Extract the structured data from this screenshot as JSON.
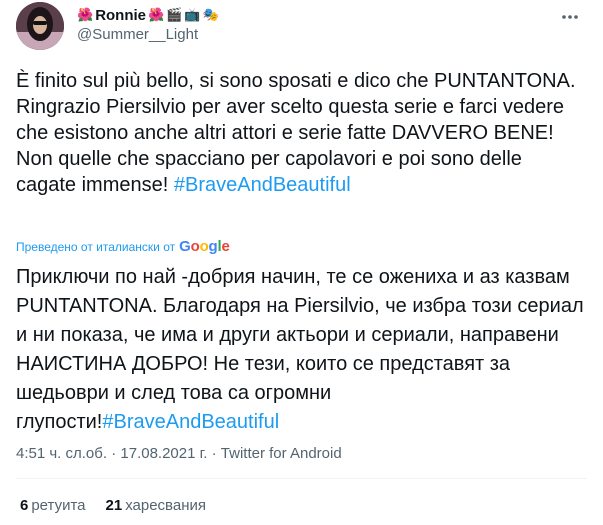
{
  "author": {
    "display_name": "Ronnie",
    "handle": "@Summer__Light",
    "name_emojis": {
      "flower1": "🌺",
      "flower2": "🌺",
      "clapper": "🎬",
      "tv": "📺",
      "masks": "🎭"
    }
  },
  "icons": {
    "more": "more-options-icon",
    "google": "google-logo"
  },
  "tweet": {
    "text_before_hashtag": "È finito sul più bello, si sono sposati e dico che PUNTANTONA. Ringrazio Piersilvio per aver scelto questa serie e farci vedere che esistono anche altri attori e serie fatte DAVVERO BENE! Non quelle che spacciano per capolavori e poi sono delle cagate immense! ",
    "hashtag": "#BraveAndBeautiful",
    "translated_label": "Преведено от италиански от",
    "google_letters": [
      "G",
      "o",
      "o",
      "g",
      "l",
      "e"
    ],
    "translation_before_hashtag": "Приключи по най -добрия начин, те се ожениха и аз казвам PUNTANTONA. Благодаря на Piersilvio, че избра този сериал и ни показа, че има и други актьори и сериали, направени НАИСТИНА ДОБРО! Не тези, които се представят за шедьоври и след това са огромни глупости!",
    "translation_hashtag": "#BraveAndBeautiful"
  },
  "meta": {
    "time": "4:51 ч. сл.об.",
    "separator": "·",
    "date": "17.08.2021 г.",
    "source": "Twitter for Android"
  },
  "stats": {
    "retweets_count": "6",
    "retweets_label": "ретуита",
    "likes_count": "21",
    "likes_label": "харесвания"
  },
  "colors": {
    "accent": "#1d9bf0",
    "secondary_text": "#536471",
    "primary_text": "#0f1419",
    "divider": "#eff3f4"
  }
}
